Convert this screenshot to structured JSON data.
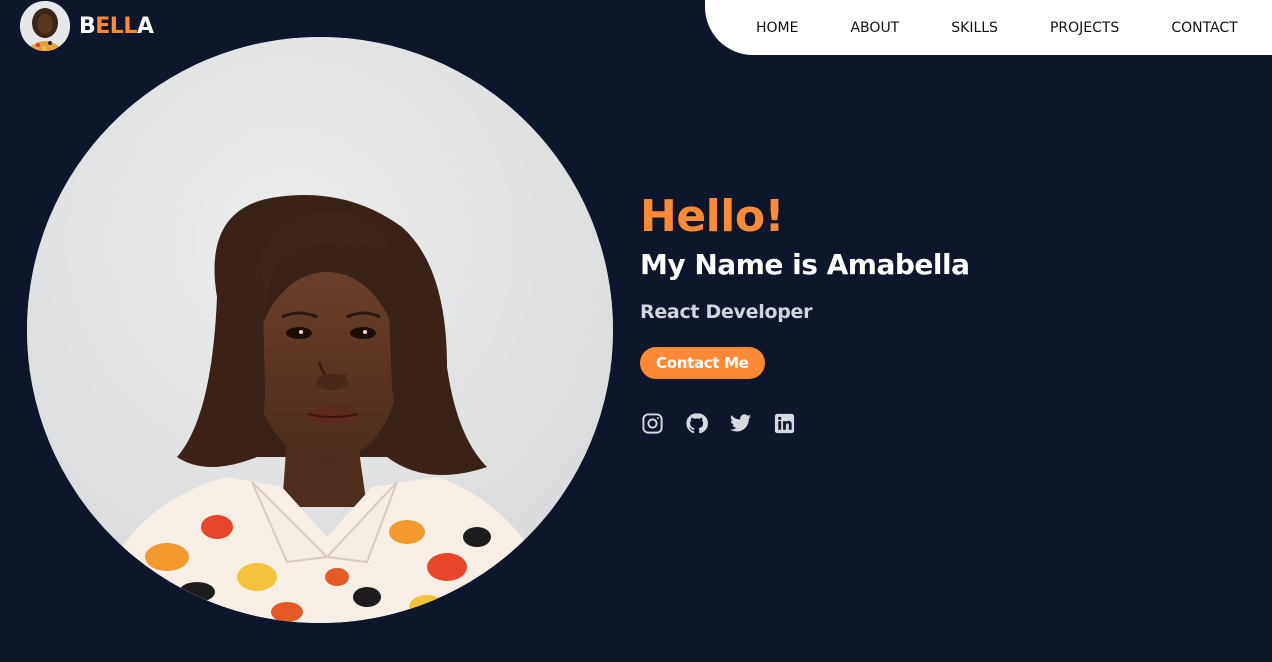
{
  "logo": {
    "text_part1": "B",
    "text_part2": "ELL",
    "text_part3": "A"
  },
  "nav": {
    "items": [
      {
        "label": "HOME"
      },
      {
        "label": "ABOUT"
      },
      {
        "label": "SKILLS"
      },
      {
        "label": "PROJECTS"
      },
      {
        "label": "CONTACT"
      }
    ]
  },
  "hero": {
    "greeting": "Hello!",
    "name": "My Name is Amabella",
    "role": "React Developer",
    "cta_label": "Contact Me",
    "socials": [
      {
        "icon": "instagram-icon"
      },
      {
        "icon": "github-icon"
      },
      {
        "icon": "twitter-icon"
      },
      {
        "icon": "linkedin-icon"
      }
    ]
  },
  "colors": {
    "background": "#0e162b",
    "accent": "#ff8a36",
    "nav_bg": "#ffffff"
  }
}
